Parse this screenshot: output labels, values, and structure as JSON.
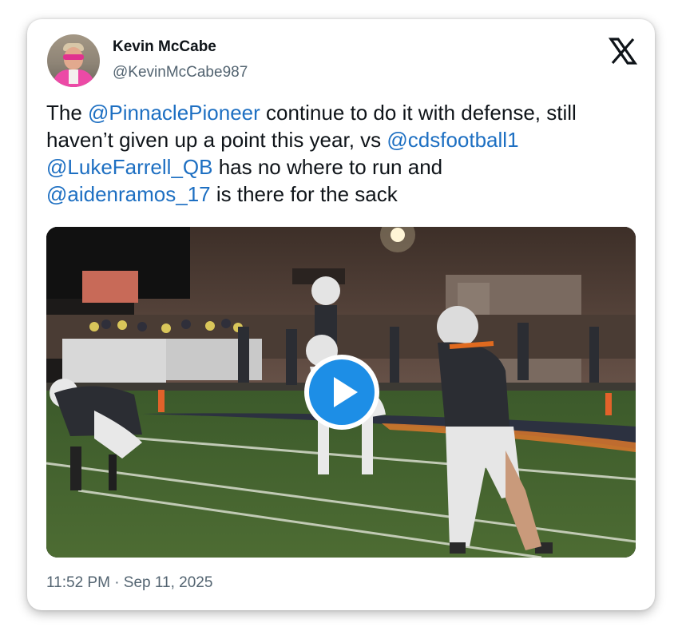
{
  "author": {
    "name": "Kevin McCabe",
    "handle": "@KevinMcCabe987"
  },
  "tweet": {
    "segments": [
      {
        "text": "The ",
        "type": "text"
      },
      {
        "text": "@PinnaclePioneer",
        "type": "mention"
      },
      {
        "text": " continue to do it with defense, still haven’t given up a point this year, vs ",
        "type": "text"
      },
      {
        "text": "@cdsfootball1",
        "type": "mention"
      },
      {
        "text": " ",
        "type": "text"
      },
      {
        "text": "@LukeFarrell_QB",
        "type": "mention"
      },
      {
        "text": " has no where to run and ",
        "type": "text"
      },
      {
        "text": "@aidenramos_17",
        "type": "mention"
      },
      {
        "text": " is there for the sack",
        "type": "text"
      }
    ],
    "timestamp": "11:52 PM · Sep 11, 2025"
  },
  "icons": {
    "platform_logo": "x-logo-icon",
    "play": "play-icon"
  },
  "colors": {
    "mention": "#1d6fc2",
    "play_button": "#1d8ee6",
    "jersey": "#2b2d33",
    "jersey_trim": "#e06a1f"
  }
}
